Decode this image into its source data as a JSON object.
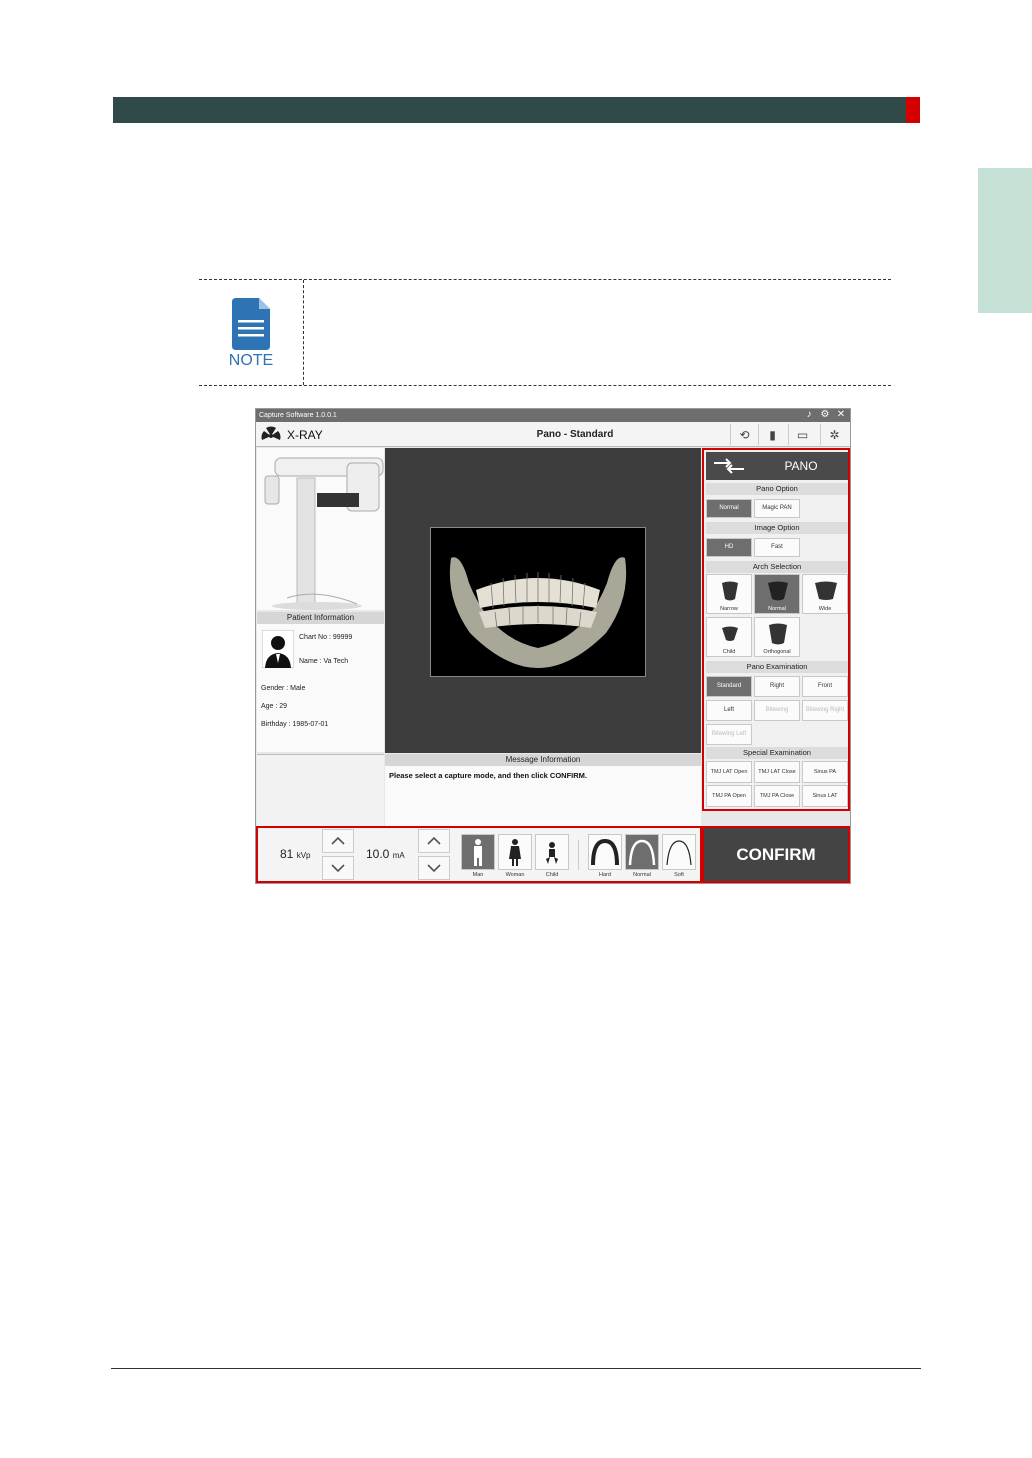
{
  "note": {
    "label": "NOTE"
  },
  "window": {
    "title": "Capture Software  1.0.0.1",
    "app_label": "X-RAY",
    "mode_title": "Pano - Standard",
    "toolbar_icons": [
      "sound-icon",
      "settings-icon",
      "close-icon",
      "off-rotate-icon",
      "sensor-icon",
      "layers-icon",
      "laser-icon"
    ]
  },
  "patient": {
    "header": "Patient Information",
    "chart_no": "Chart No : 99999",
    "name": "Name : Va Tech",
    "gender": "Gender : Male",
    "age": "Age : 29",
    "birthday": "Birthday : 1985-07-01"
  },
  "message": {
    "header": "Message Information",
    "text": "Please select a capture mode, and then click CONFIRM."
  },
  "right_panel": {
    "mode": "PANO",
    "pano_option": {
      "header": "Pano Option",
      "items": [
        "Normal",
        "Magic PAN"
      ],
      "selected": 0
    },
    "image_option": {
      "header": "Image Option",
      "items": [
        "HD",
        "Fast"
      ],
      "selected": 0
    },
    "arch_selection": {
      "header": "Arch Selection",
      "items": [
        "Narrow",
        "Normal",
        "Wide",
        "Child",
        "Orthogonal"
      ],
      "selected": 1
    },
    "pano_examination": {
      "header": "Pano Examination",
      "items": [
        "Standard",
        "Right",
        "Front",
        "Left",
        "Bitewing",
        "Bitewing Right",
        "Bitewing Left"
      ],
      "selected": 0
    },
    "special_examination": {
      "header": "Special Examination",
      "items": [
        "TMJ LAT Open",
        "TMJ LAT Close",
        "Sinus PA",
        "TMJ PA Open",
        "TMJ PA Close",
        "Sinus LAT"
      ]
    }
  },
  "bottom": {
    "kvp_value": "81",
    "kvp_unit": "kVp",
    "ma_value": "10.0",
    "ma_unit": "mA",
    "patient_types": [
      "Man",
      "Woman",
      "Child"
    ],
    "patient_selected": 0,
    "arch_types": [
      "Hard",
      "Normal",
      "Soft"
    ],
    "arch_selected": 1,
    "confirm_label": "CONFIRM"
  },
  "colors": {
    "header_bar": "#2f4a48",
    "accent_red": "#d40000",
    "side_tab": "#c5e0d4",
    "note_blue": "#2e74b5"
  }
}
